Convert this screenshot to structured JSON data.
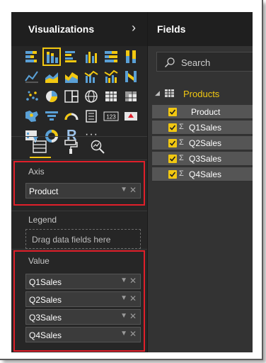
{
  "visualizations": {
    "title": "Visualizations",
    "expand_icon": "chevron-right-icon",
    "icons": [
      "stacked-bar-chart-icon",
      "stacked-column-chart-icon",
      "clustered-bar-chart-icon",
      "clustered-column-chart-icon",
      "100-stacked-bar-chart-icon",
      "100-stacked-column-chart-icon",
      "line-chart-icon",
      "area-chart-icon",
      "stacked-area-chart-icon",
      "line-and-stacked-column-chart-icon",
      "line-and-clustered-column-chart-icon",
      "ribbon-chart-icon",
      "scatter-chart-icon",
      "pie-chart-icon",
      "treemap-icon",
      "globe-map-icon",
      "table-icon",
      "matrix-icon",
      "filled-map-icon",
      "funnel-icon",
      "gauge-icon",
      "multi-row-card-icon",
      "card-icon",
      "kpi-icon",
      "slicer-icon",
      "donut-chart-icon",
      "r-script-icon",
      "more-options-icon"
    ],
    "card_text": "123",
    "r_text": "R",
    "more_text": "···",
    "tabs": [
      "fields-tab-icon",
      "format-paint-roller-icon",
      "analytics-magnifier-icon"
    ]
  },
  "wells": {
    "axis": {
      "label": "Axis",
      "fields": [
        "Product"
      ]
    },
    "legend": {
      "label": "Legend",
      "placeholder": "Drag data fields here"
    },
    "value": {
      "label": "Value",
      "fields": [
        "Q1Sales",
        "Q2Sales",
        "Q3Sales",
        "Q4Sales"
      ]
    },
    "chip_remove": "✕",
    "chip_caret": "▼"
  },
  "fields": {
    "title": "Fields",
    "search_placeholder": "Search",
    "table": {
      "name": "Products",
      "caret": "◢"
    },
    "items": [
      {
        "name": "Product",
        "checked": true,
        "aggregate": false
      },
      {
        "name": "Q1Sales",
        "checked": true,
        "aggregate": true
      },
      {
        "name": "Q2Sales",
        "checked": true,
        "aggregate": true
      },
      {
        "name": "Q3Sales",
        "checked": true,
        "aggregate": true
      },
      {
        "name": "Q4Sales",
        "checked": true,
        "aggregate": true
      }
    ],
    "sigma": "Σ"
  },
  "colors": {
    "accent": "#f2c811",
    "highlight_border": "#e01f2a",
    "pane_bg": "#262626"
  }
}
